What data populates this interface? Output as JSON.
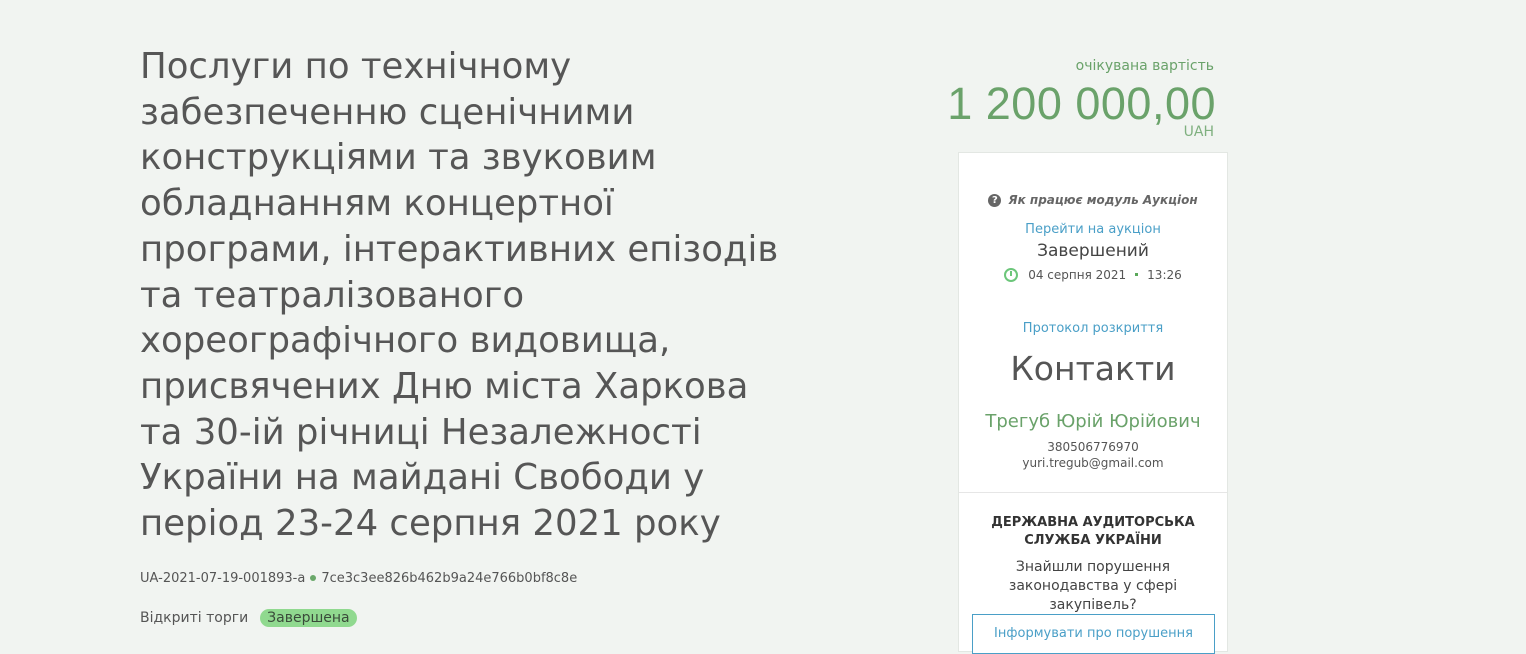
{
  "tender": {
    "title": "Послуги по технічному забезпеченню сценічними конструкціями та звуковим обладнанням концертної програми, інтерактивних епізодів та театралізованого хореографічного видовища, присвячених Дню міста Харкова та 30-ій річниці Незалежності України на майдані Свободи у період 23-24 серпня 2021 року",
    "tender_id": "UA-2021-07-19-001893-a",
    "hash": "7ce3c3ee826b462b9a24e766b0bf8c8e",
    "procedure": "Відкриті торги",
    "status_badge": "Завершена"
  },
  "price": {
    "label": "очікувана вартість",
    "amount": "1 200 000,00",
    "currency": "UAH"
  },
  "auction": {
    "how_it_works": "Як працює модуль Аукціон",
    "go_to_auction": "Перейти на аукціон",
    "status": "Завершений",
    "date": "04 серпня 2021",
    "time": "13:26",
    "protocol_link": "Протокол розкриття"
  },
  "contacts": {
    "title": "Контакти",
    "name": "Трегуб Юрій Юрійович",
    "phone": "380506776970",
    "email": "yuri.tregub@gmail.com"
  },
  "audit": {
    "title": "ДЕРЖАВНА АУДИТОРСЬКА СЛУЖБА УКРАЇНИ",
    "question": "Знайшли порушення законодавства у сфері закупівель?",
    "button_label": "Інформувати про порушення"
  },
  "colors": {
    "background": "#f1f4f1",
    "price_green": "#6aa26a",
    "link_blue": "#4a9fc7",
    "badge_green": "#90d98f"
  }
}
